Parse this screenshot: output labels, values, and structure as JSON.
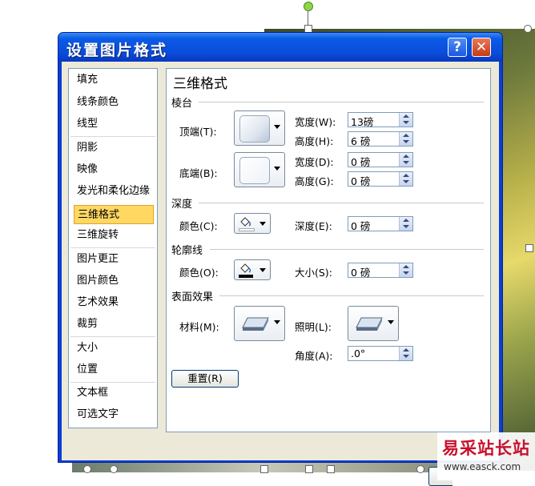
{
  "dialog": {
    "title": "设置图片格式",
    "help_label": "?",
    "close_label": "✕"
  },
  "nav": {
    "items": [
      {
        "label": "填充"
      },
      {
        "label": "线条颜色"
      },
      {
        "label": "线型"
      },
      {
        "label": "阴影"
      },
      {
        "label": "映像"
      },
      {
        "label": "发光和柔化边缘"
      },
      {
        "label": "三维格式",
        "selected": true
      },
      {
        "label": "三维旋转"
      },
      {
        "label": "图片更正"
      },
      {
        "label": "图片颜色"
      },
      {
        "label": "艺术效果"
      },
      {
        "label": "裁剪"
      },
      {
        "label": "大小"
      },
      {
        "label": "位置"
      },
      {
        "label": "文本框"
      },
      {
        "label": "可选文字"
      }
    ]
  },
  "panel": {
    "title": "三维格式",
    "bevel": {
      "heading": "棱台",
      "top_label": "顶端(T):",
      "bottom_label": "底端(B):",
      "top_width_label": "宽度(W):",
      "top_width_value": "13磅",
      "top_height_label": "高度(H):",
      "top_height_value": "6 磅",
      "bottom_width_label": "宽度(D):",
      "bottom_width_value": "0 磅",
      "bottom_height_label": "高度(G):",
      "bottom_height_value": "0 磅"
    },
    "depth": {
      "heading": "深度",
      "color_label": "颜色(C):",
      "depth_label": "深度(E):",
      "depth_value": "0 磅"
    },
    "contour": {
      "heading": "轮廓线",
      "color_label": "颜色(O):",
      "size_label": "大小(S):",
      "size_value": "0 磅"
    },
    "surface": {
      "heading": "表面效果",
      "material_label": "材料(M):",
      "lighting_label": "照明(L):",
      "angle_label": "角度(A):",
      "angle_value": ".0°"
    },
    "reset_label": "重置(R)"
  },
  "watermark": {
    "title": "易采站长站",
    "url": "www.easck.com"
  }
}
